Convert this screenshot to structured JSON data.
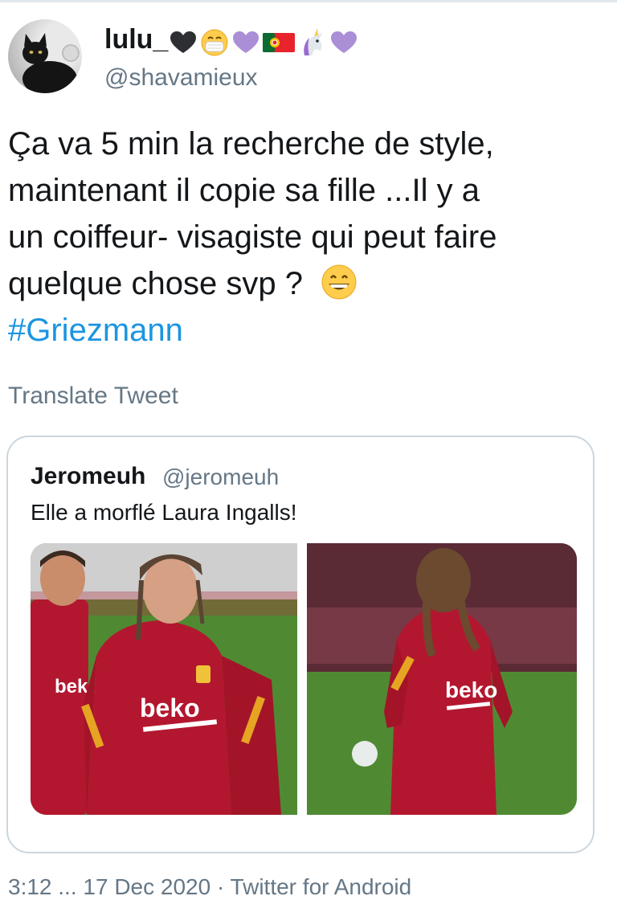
{
  "tweet": {
    "display_name": "lulu_",
    "display_name_emojis": [
      "black-heart",
      "face-with-medical-mask",
      "purple-heart",
      "portugal-flag",
      "unicorn",
      "purple-heart"
    ],
    "handle": "@shavamieux",
    "text_lines": [
      "Ça va 5 min la recherche de style,",
      "maintenant il copie sa fille ...Il y a",
      "un coiffeur- visagiste qui peut faire",
      "quelque chose svp ?"
    ],
    "text_emoji": "grinning-face",
    "hashtag": "#Griezmann",
    "translate_label": "Translate Tweet",
    "footer_meta": "3:12 ... 17 Dec 2020 · Twitter for Android"
  },
  "quoted_tweet": {
    "display_name": "Jeromeuh",
    "handle": "@jeromeuh",
    "text": "Elle a morflé Laura Ingalls!",
    "photos": [
      {
        "name": "photo-players-training",
        "jersey_text": "beko"
      },
      {
        "name": "photo-girl-back",
        "jersey_text": "beko"
      }
    ]
  },
  "colors": {
    "text": "#14171a",
    "secondary": "#657786",
    "link": "#1b95e0",
    "border": "#ccd6dd",
    "jersey": "#b3172f",
    "pitch": "#4f8a33"
  }
}
